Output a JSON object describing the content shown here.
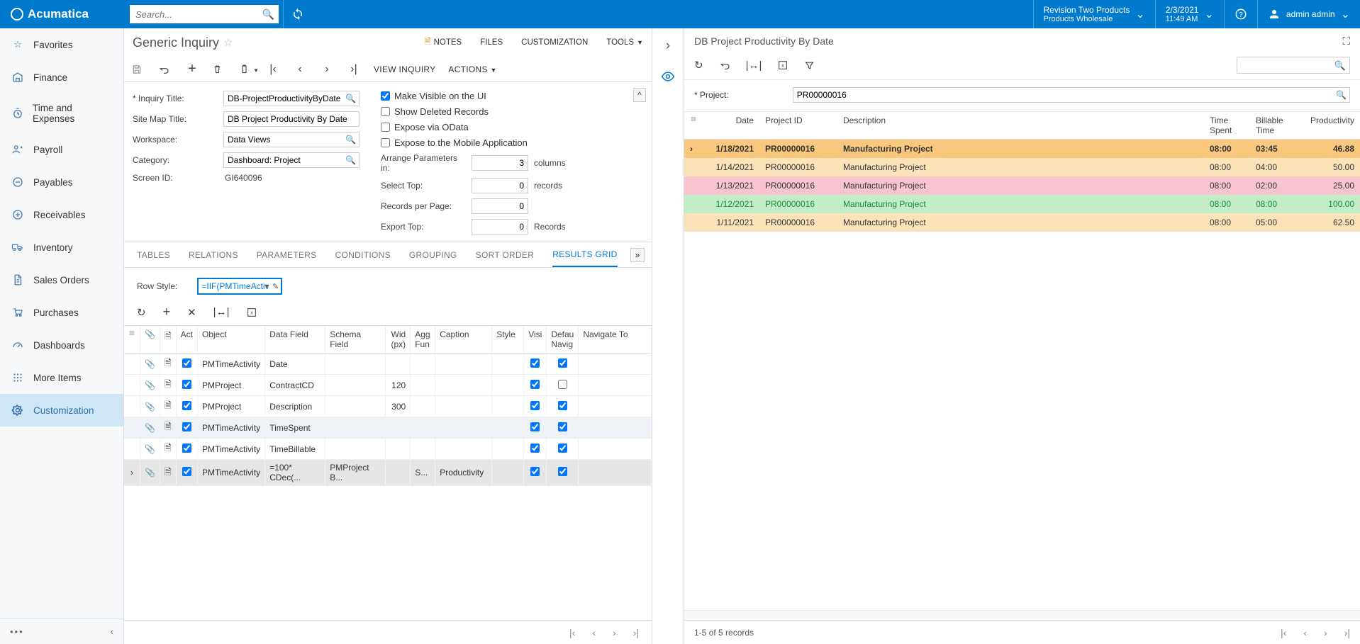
{
  "header": {
    "brand": "Acumatica",
    "search_placeholder": "Search...",
    "tenant_line1": "Revision Two Products",
    "tenant_line2": "Products Wholesale",
    "date_line1": "2/3/2021",
    "date_line2": "11:49 AM",
    "user": "admin admin"
  },
  "nav": [
    {
      "label": "Favorites"
    },
    {
      "label": "Finance"
    },
    {
      "label": "Time and Expenses"
    },
    {
      "label": "Payroll"
    },
    {
      "label": "Payables"
    },
    {
      "label": "Receivables"
    },
    {
      "label": "Inventory"
    },
    {
      "label": "Sales Orders"
    },
    {
      "label": "Purchases"
    },
    {
      "label": "Dashboards"
    },
    {
      "label": "More Items"
    },
    {
      "label": "Customization"
    }
  ],
  "screen": {
    "title": "Generic Inquiry",
    "menu_notes": "NOTES",
    "menu_files": "FILES",
    "menu_customization": "CUSTOMIZATION",
    "menu_tools": "TOOLS"
  },
  "toolbar": {
    "view_inquiry": "VIEW INQUIRY",
    "actions": "ACTIONS"
  },
  "form": {
    "inquiry_title_label": "Inquiry Title:",
    "inquiry_title_value": "DB-ProjectProductivityByDate",
    "site_map_title_label": "Site Map Title:",
    "site_map_title_value": "DB Project Productivity By Date",
    "workspace_label": "Workspace:",
    "workspace_value": "Data Views",
    "category_label": "Category:",
    "category_value": "Dashboard: Project",
    "screen_id_label": "Screen ID:",
    "screen_id_value": "GI640096",
    "make_visible": "Make Visible on the UI",
    "show_deleted": "Show Deleted Records",
    "expose_odata": "Expose via OData",
    "expose_mobile": "Expose to the Mobile Application",
    "arrange_params_label": "Arrange Parameters in:",
    "arrange_params_value": "3",
    "arrange_params_unit": "columns",
    "select_top_label": "Select Top:",
    "select_top_value": "0",
    "select_top_unit": "records",
    "records_per_page_label": "Records per Page:",
    "records_per_page_value": "0",
    "export_top_label": "Export Top:",
    "export_top_value": "0",
    "export_top_unit": "Records"
  },
  "tabs": [
    "TABLES",
    "RELATIONS",
    "PARAMETERS",
    "CONDITIONS",
    "GROUPING",
    "SORT ORDER",
    "RESULTS GRID"
  ],
  "row_style_label": "Row Style:",
  "row_style_value": "=IIF(PMTimeActivi",
  "grid": {
    "headers": {
      "act": "Act",
      "object": "Object",
      "data_field": "Data Field",
      "schema_field": "Schema Field",
      "width": "Wid (px)",
      "agg": "Agg Fun",
      "caption": "Caption",
      "style": "Style",
      "visible": "Visi",
      "default_nav": "Defau Navig",
      "navigate_to": "Navigate To"
    },
    "rows": [
      {
        "object": "PMTimeActivity",
        "data_field": "Date",
        "schema": "",
        "width": "",
        "agg": "",
        "caption": "",
        "visible": true,
        "defnav": true
      },
      {
        "object": "PMProject",
        "data_field": "ContractCD",
        "schema": "",
        "width": "120",
        "agg": "",
        "caption": "",
        "visible": true,
        "defnav": false
      },
      {
        "object": "PMProject",
        "data_field": "Description",
        "schema": "",
        "width": "300",
        "agg": "",
        "caption": "",
        "visible": true,
        "defnav": true
      },
      {
        "object": "PMTimeActivity",
        "data_field": "TimeSpent",
        "schema": "",
        "width": "",
        "agg": "",
        "caption": "",
        "visible": true,
        "defnav": true
      },
      {
        "object": "PMTimeActivity",
        "data_field": "TimeBillable",
        "schema": "",
        "width": "",
        "agg": "",
        "caption": "",
        "visible": true,
        "defnav": true
      },
      {
        "object": "PMTimeActivity",
        "data_field": "=100* CDec(...",
        "schema": "PMProject B...",
        "width": "",
        "agg": "S...",
        "caption": "Productivity",
        "visible": true,
        "defnav": true
      }
    ]
  },
  "preview": {
    "title": "DB Project Productivity By Date",
    "project_label": "Project:",
    "project_value": "PR00000016",
    "headers": {
      "date": "Date",
      "project_id": "Project ID",
      "description": "Description",
      "time_spent": "Time Spent",
      "billable_time": "Billable Time",
      "productivity": "Productivity"
    },
    "rows": [
      {
        "class": "row-orange",
        "date": "1/18/2021",
        "project_id": "PR00000016",
        "description": "Manufacturing Project",
        "time_spent": "08:00",
        "billable_time": "03:45",
        "productivity": "46.88"
      },
      {
        "class": "row-orange-lt",
        "date": "1/14/2021",
        "project_id": "PR00000016",
        "description": "Manufacturing Project",
        "time_spent": "08:00",
        "billable_time": "04:00",
        "productivity": "50.00"
      },
      {
        "class": "row-pink",
        "date": "1/13/2021",
        "project_id": "PR00000016",
        "description": "Manufacturing Project",
        "time_spent": "08:00",
        "billable_time": "02:00",
        "productivity": "25.00"
      },
      {
        "class": "row-green",
        "date": "1/12/2021",
        "project_id": "PR00000016",
        "description": "Manufacturing Project",
        "time_spent": "08:00",
        "billable_time": "08:00",
        "productivity": "100.00"
      },
      {
        "class": "row-orange-lt",
        "date": "1/11/2021",
        "project_id": "PR00000016",
        "description": "Manufacturing Project",
        "time_spent": "08:00",
        "billable_time": "05:00",
        "productivity": "62.50"
      }
    ],
    "record_count": "1-5 of 5 records"
  }
}
